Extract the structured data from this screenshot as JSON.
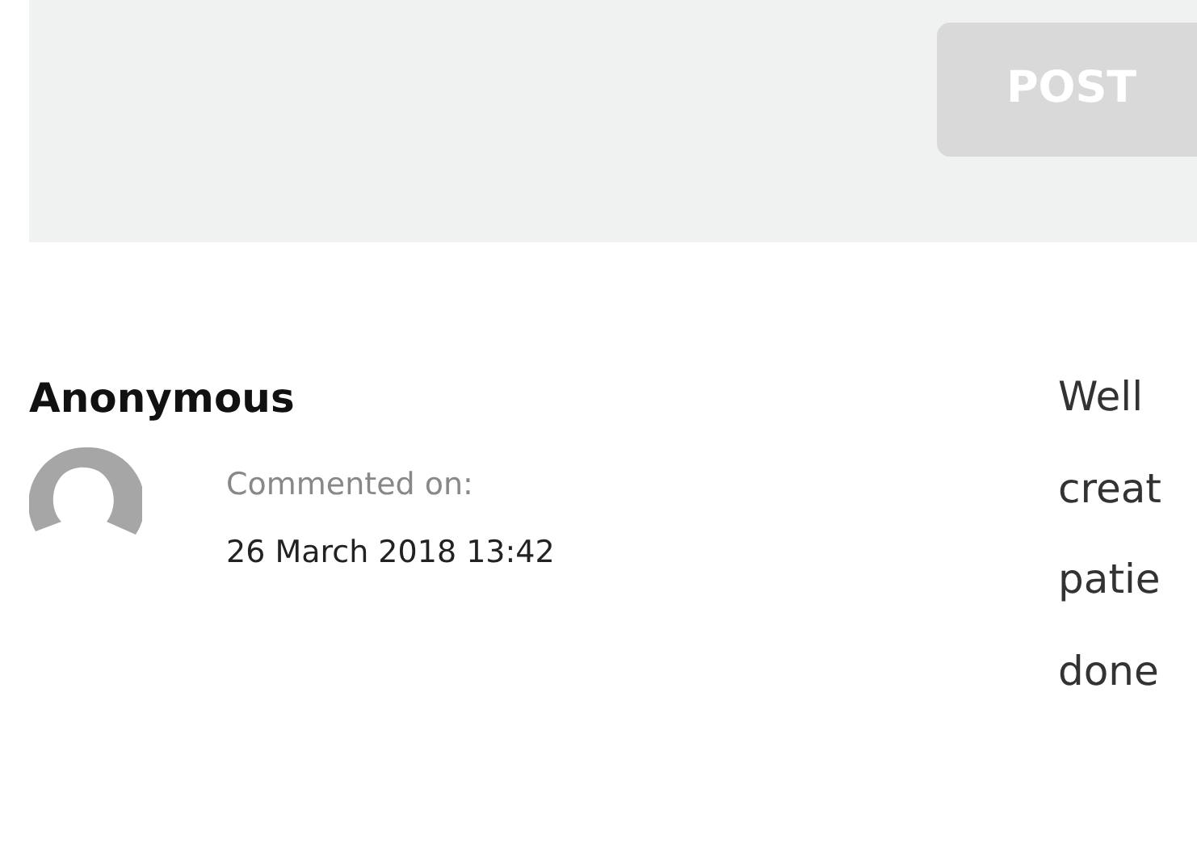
{
  "post_button": {
    "label": "POST",
    "disabled": true
  },
  "comment": {
    "author": "Anonymous",
    "meta_label": "Commented on:",
    "date": "26 March 2018 13:42",
    "text_lines": [
      "Well",
      "creat",
      "patie",
      "done"
    ]
  }
}
